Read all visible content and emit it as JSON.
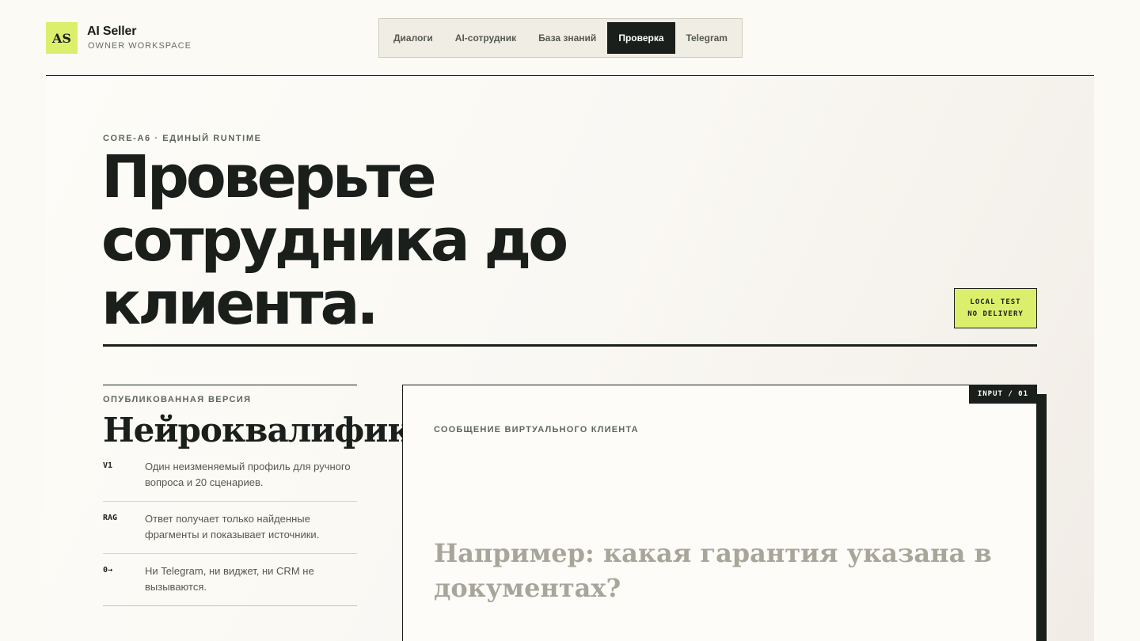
{
  "brand": {
    "logo_text": "AS",
    "name": "AI Seller",
    "subtitle": "OWNER WORKSPACE"
  },
  "nav": {
    "tabs": [
      {
        "label": "Диалоги",
        "active": false
      },
      {
        "label": "AI-сотрудник",
        "active": false
      },
      {
        "label": "База знаний",
        "active": false
      },
      {
        "label": "Проверка",
        "active": true
      },
      {
        "label": "Telegram",
        "active": false
      }
    ]
  },
  "hero": {
    "eyebrow": "CORE-A6 · ЕДИНЫЙ RUNTIME",
    "title": "Проверьте сотрудника до клиента.",
    "badge_line1": "LOCAL TEST",
    "badge_line2": "NO DELIVERY"
  },
  "version": {
    "label": "ОПУБЛИКОВАННАЯ ВЕРСИЯ",
    "name": "Нейроквалификатор",
    "features": [
      {
        "key": "V1",
        "text": "Один неизменяемый профиль для ручного вопроса и 20 сценариев."
      },
      {
        "key": "RAG",
        "text": "Ответ получает только найденные фрагменты и показывает источники."
      },
      {
        "key": "0→",
        "text": "Ни Telegram, ни виджет, ни CRM не вызываются."
      }
    ]
  },
  "input_card": {
    "tag": "INPUT / 01",
    "label": "СООБЩЕНИЕ ВИРТУАЛЬНОГО КЛИЕНТА",
    "placeholder": "Например: какая гарантия указана в документах?"
  },
  "colors": {
    "accent": "#dcef6c",
    "ink": "#1a1f1b",
    "background": "#fbfaf5"
  }
}
